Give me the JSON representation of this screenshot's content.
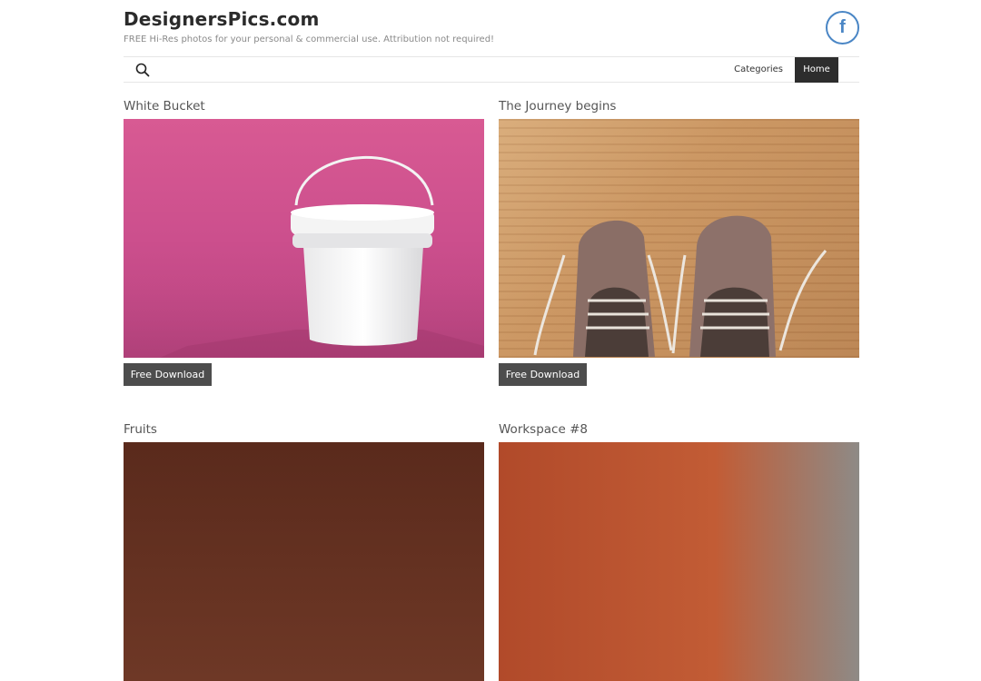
{
  "header": {
    "site_title": "DesignersPics.com",
    "tagline": "FREE Hi-Res photos for your personal & commercial use. Attribution not required!",
    "facebook_glyph": "f"
  },
  "nav": {
    "search_icon": "search-icon",
    "items": [
      {
        "label": "Categories",
        "active": false
      },
      {
        "label": "Home",
        "active": true
      }
    ]
  },
  "posts": [
    {
      "title": "White Bucket",
      "button": "Free Download",
      "image_icon": "white-bucket-photo"
    },
    {
      "title": "The Journey begins",
      "button": "Free Download",
      "image_icon": "shoes-photo"
    },
    {
      "title": "Fruits",
      "image_icon": "fruits-photo"
    },
    {
      "title": "Workspace #8",
      "image_icon": "workspace-photo"
    }
  ],
  "colors": {
    "nav_active_bg": "#2d2d2d",
    "button_bg": "#4d4d4d",
    "facebook_blue": "#4a86c5",
    "bucket_bg": "#cc4f8d"
  }
}
